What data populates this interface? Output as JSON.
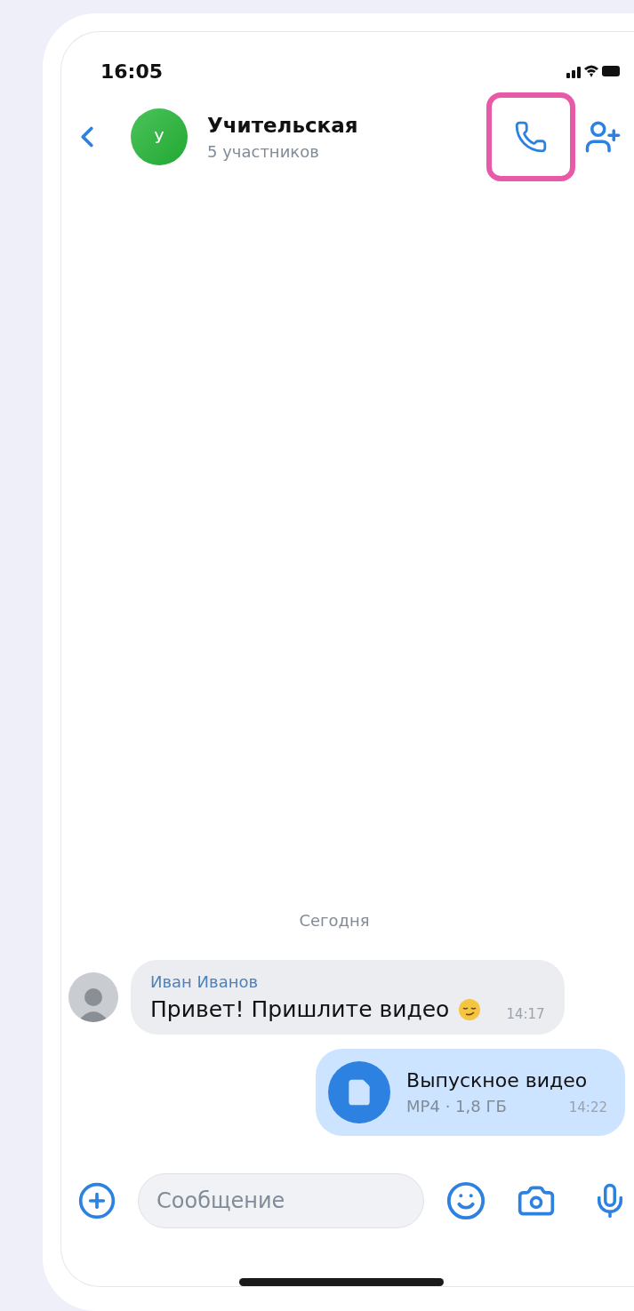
{
  "status_bar": {
    "time": "16:05"
  },
  "header": {
    "title": "Учительская",
    "subtitle": "5 участников",
    "avatar_letter": "У",
    "actions": [
      {
        "kind": "call",
        "highlighted": true
      },
      {
        "kind": "add-member",
        "highlighted": false
      }
    ]
  },
  "date_separator": "Сегодня",
  "messages": [
    {
      "kind": "incoming",
      "sender": "Иван Иванов",
      "text": "Привет! Пришлите видео",
      "time": "14:17"
    },
    {
      "kind": "outgoing",
      "file_name": "Выпускное видео",
      "file_meta": "MP4 · 1,8 ГБ",
      "time": "14:22"
    }
  ],
  "composer": {
    "placeholder": "Сообщение"
  }
}
